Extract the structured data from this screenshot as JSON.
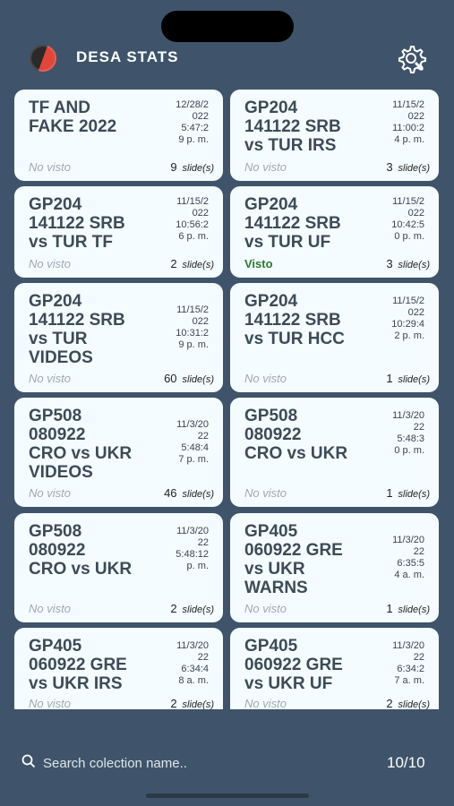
{
  "app": {
    "title": "DESA STATS"
  },
  "unit_label": "slide(s)",
  "cards": [
    {
      "title": "TF AND\nFAKE 2022",
      "date": "12/28/2\n022\n5:47:2\n9 p. m.",
      "status": "No visto",
      "count": "9"
    },
    {
      "title": "GP204\n141122 SRB\nvs TUR IRS",
      "date": "11/15/2\n022\n11:00:2\n4 p. m.",
      "status": "No visto",
      "count": "3"
    },
    {
      "title": "GP204\n141122 SRB\nvs TUR TF",
      "date": "11/15/2\n022\n10:56:2\n6 p. m.",
      "status": "No visto",
      "count": "2"
    },
    {
      "title": "GP204\n141122 SRB\nvs TUR UF",
      "date": "11/15/2\n022\n10:42:5\n0 p. m.",
      "status": "Visto",
      "count": "3"
    },
    {
      "title": "GP204\n141122 SRB\nvs TUR\nVIDEOS",
      "date": "11/15/2\n022\n10:31:2\n9 p. m.",
      "status": "No visto",
      "count": "60"
    },
    {
      "title": "GP204\n141122 SRB\nvs TUR HCC",
      "date": "11/15/2\n022\n10:29:4\n2 p. m.",
      "status": "No visto",
      "count": "1"
    },
    {
      "title": "GP508\n080922\nCRO vs UKR\nVIDEOS",
      "date": "11/3/20\n22\n5:48:4\n7 p. m.",
      "status": "No visto",
      "count": "46"
    },
    {
      "title": "GP508\n080922\nCRO vs UKR",
      "date": "11/3/20\n22\n5:48:3\n0 p. m.",
      "status": "No visto",
      "count": "1"
    },
    {
      "title": "GP508\n080922\nCRO vs UKR",
      "date": "11/3/20\n22\n5:48:12\np. m.",
      "status": "No visto",
      "count": "2"
    },
    {
      "title": "GP405\n060922 GRE\nvs UKR\nWARNS",
      "date": "11/3/20\n22\n6:35:5\n4 a. m.",
      "status": "No visto",
      "count": "1"
    },
    {
      "title": "GP405\n060922 GRE\nvs UKR IRS",
      "date": "11/3/20\n22\n6:34:4\n8 a. m.",
      "status": "No visto",
      "count": "2"
    },
    {
      "title": "GP405\n060922 GRE\nvs UKR UF",
      "date": "11/3/20\n22\n6:34:2\n7 a. m.",
      "status": "No visto",
      "count": "2"
    }
  ],
  "search": {
    "placeholder": "Search colection name..",
    "value": ""
  },
  "pagination": {
    "label": "10/10"
  },
  "colors": {
    "background": "#3f546a",
    "card": "#f4fcff",
    "seen": "#2a7a2a",
    "unseen": "#9ea9b2"
  },
  "icons": {
    "logo": "app-logo",
    "settings": "gear-wrench-icon",
    "search": "search-icon"
  }
}
